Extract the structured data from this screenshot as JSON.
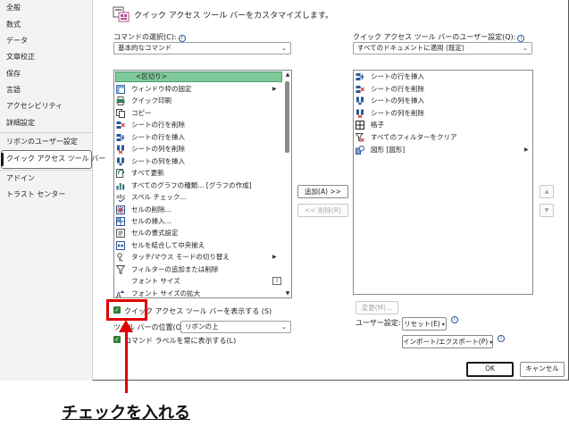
{
  "nav": {
    "items": [
      "全般",
      "数式",
      "データ",
      "文章校正",
      "保存",
      "言語",
      "アクセシビリティ",
      "詳細設定",
      "リボンのユーザー設定",
      "クイック アクセス ツール バー",
      "アドイン",
      "トラスト センター"
    ],
    "active_index": 9
  },
  "header": {
    "title": "クイック アクセス ツール バーをカスタマイズします。"
  },
  "left": {
    "choose_label": "コマンドの選択(C):",
    "choose_value": "基本的なコマンド",
    "separator_label": "<区切り>",
    "items": [
      {
        "label": "ウィンドウ枠の固定",
        "icon": "freeze-panes-icon",
        "sub": true
      },
      {
        "label": "クイック印刷",
        "icon": "quick-print-icon",
        "sub": false
      },
      {
        "label": "コピー",
        "icon": "copy-icon",
        "sub": false
      },
      {
        "label": "シートの行を削除",
        "icon": "delete-row-icon",
        "sub": false
      },
      {
        "label": "シートの行を挿入",
        "icon": "insert-row-icon",
        "sub": false
      },
      {
        "label": "シートの列を削除",
        "icon": "delete-column-icon",
        "sub": false
      },
      {
        "label": "シートの列を挿入",
        "icon": "insert-column-icon",
        "sub": false
      },
      {
        "label": "すべて更新",
        "icon": "refresh-all-icon",
        "sub": false
      },
      {
        "label": "すべてのグラフの種類... [グラフの作成]",
        "icon": "chart-icon",
        "sub": false
      },
      {
        "label": "スペル チェック...",
        "icon": "spell-check-icon",
        "sub": false
      },
      {
        "label": "セルの削除...",
        "icon": "delete-cells-icon",
        "sub": false
      },
      {
        "label": "セルの挿入...",
        "icon": "insert-cells-icon",
        "sub": false
      },
      {
        "label": "セルの書式設定",
        "icon": "format-cells-icon",
        "sub": false
      },
      {
        "label": "セルを結合して中央揃え",
        "icon": "merge-center-icon",
        "sub": false
      },
      {
        "label": "タッチ/マウス モードの切り替え",
        "icon": "touch-mouse-icon",
        "sub": true
      },
      {
        "label": "フィルターの追加または削除",
        "icon": "filter-icon",
        "sub": false
      },
      {
        "label": "フォント サイズ",
        "icon": "font-size-icon",
        "sub": false
      },
      {
        "label": "フォント サイズの拡大",
        "icon": "font-grow-icon",
        "sub": false
      }
    ],
    "show_qat_label": "クイック アクセス ツール バーを表示する (S)",
    "toolbar_pos_label": "ツール バーの位置(O)",
    "toolbar_pos_value": "リボンの上",
    "always_labels_label": "コマンド ラベルを常に表示する(L)"
  },
  "middle": {
    "add_label": "追加(A) >>",
    "remove_label": "<< 削除(R)"
  },
  "right": {
    "customize_label": "クイック アクセス ツール バーのユーザー設定(Q):",
    "customize_value": "すべてのドキュメントに適用 (既定)",
    "items": [
      {
        "label": "シートの行を挿入",
        "icon": "insert-row-icon",
        "sub": false
      },
      {
        "label": "シートの行を削除",
        "icon": "delete-row-icon",
        "sub": false
      },
      {
        "label": "シートの列を挿入",
        "icon": "insert-column-icon",
        "sub": false
      },
      {
        "label": "シートの列を削除",
        "icon": "delete-column-icon",
        "sub": false
      },
      {
        "label": "格子",
        "icon": "grid-border-icon",
        "sub": false
      },
      {
        "label": "すべてのフィルターをクリア",
        "icon": "clear-filter-icon",
        "sub": false
      },
      {
        "label": "図形 [図形]",
        "icon": "shapes-icon",
        "sub": true
      }
    ],
    "modify_label": "変更(M)...",
    "user_settings_label": "ユーザー設定:",
    "reset_label": "リセット(E)",
    "import_export_label": "インポート/エクスポート(P)"
  },
  "footer": {
    "ok_label": "OK",
    "cancel_label": "キャンセル"
  },
  "annotation": {
    "text": "チェックを入れる",
    "color": "#e00000"
  }
}
